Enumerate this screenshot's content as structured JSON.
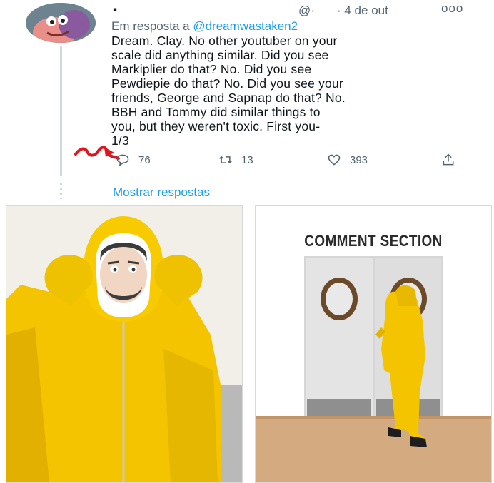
{
  "tweet": {
    "display_name": "▪",
    "handle": "@·",
    "date": "· 4 de out",
    "more_label": "ooo",
    "replying_prefix": "Em resposta a",
    "replying_mention": "@dreamwastaken2",
    "text": "Dream. Clay. No other youtuber on your\nscale did anything similar. Did you see\nMarkiplier do that? No. Did you see\nPewdiepie do that? No. Did you see your\nfriends, George and Sapnap do that? No.\nBBH and Tommy did similar things to\nyou, but they weren't toxic. First you-\n1/3",
    "actions": {
      "reply_count": "76",
      "retweet_count": "13",
      "like_count": "393"
    },
    "show_replies": "Mostrar respostas"
  },
  "meme": {
    "right_panel_title": "COMMENT SECTION"
  },
  "colors": {
    "link_blue": "#1d9bf0",
    "muted_gray": "#536471",
    "suit_yellow": "#f5c400",
    "scribble_red": "#e0141e"
  }
}
